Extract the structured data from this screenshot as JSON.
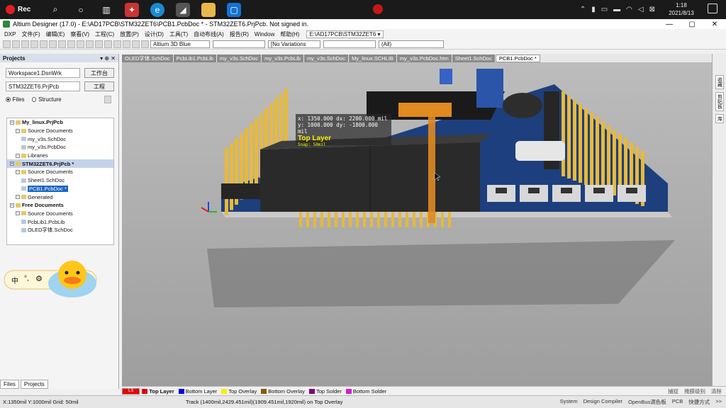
{
  "taskbar": {
    "rec_label": "Rec",
    "clock_time": "1:18",
    "clock_date": "2021/8/13"
  },
  "window": {
    "title": "Altium Designer (17.0) - E:\\AD17PCB\\STM32ZET6\\PCB1.PcbDoc * - STM32ZET6.PrjPcb. Not signed in."
  },
  "menu": {
    "items": [
      "DXP",
      "文件(F)",
      "编辑(E)",
      "察看(V)",
      "工程(C)",
      "放置(P)",
      "设计(D)",
      "工具(T)",
      "自动布线(A)",
      "报告(R)",
      "Window",
      "帮助(H)"
    ],
    "path": "E:\\AD17PCB\\STM32ZET6 ▾"
  },
  "toolbar": {
    "view_config": "Altium 3D Blue",
    "variations": "[No Variations",
    "filter": "(All)"
  },
  "projects_panel": {
    "title": "Projects",
    "workspace_value": "Workspace1.DsnWrk",
    "workspace_button": "工作台",
    "project_value": "STM32ZET6.PrjPcb",
    "project_button": "工程",
    "radio_files": "Files",
    "radio_structure": "Structure",
    "tree": [
      {
        "label": "My_linux.PrjPcb",
        "level": 0,
        "bold": true,
        "kind": "project"
      },
      {
        "label": "Source Documents",
        "level": 1,
        "kind": "folder"
      },
      {
        "label": "my_v3s.SchDoc",
        "level": 2,
        "kind": "doc"
      },
      {
        "label": "my_v3s.PcbDoc",
        "level": 2,
        "kind": "doc"
      },
      {
        "label": "Libraries",
        "level": 1,
        "kind": "folder"
      },
      {
        "label": "STM32ZET6.PrjPcb *",
        "level": 0,
        "bold": true,
        "kind": "project",
        "highlight": true
      },
      {
        "label": "Source Documents",
        "level": 1,
        "kind": "folder"
      },
      {
        "label": "Sheet1.SchDoc",
        "level": 2,
        "kind": "doc"
      },
      {
        "label": "PCB1.PcbDoc *",
        "level": 2,
        "kind": "doc",
        "selected": true
      },
      {
        "label": "Generated",
        "level": 1,
        "kind": "folder"
      },
      {
        "label": "Free Documents",
        "level": 0,
        "bold": true,
        "kind": "project"
      },
      {
        "label": "Source Documents",
        "level": 1,
        "kind": "folder"
      },
      {
        "label": "PcbLib1.PcbLib",
        "level": 2,
        "kind": "doc"
      },
      {
        "label": "OLED字体.SchDoc",
        "level": 2,
        "kind": "doc"
      }
    ],
    "bottom_tabs": [
      "Files",
      "Projects"
    ]
  },
  "ime": {
    "label": "中"
  },
  "doc_tabs": [
    "OLED字体.SchDoc",
    "PcbLib1.PcbLib",
    "my_v3s.SchDoc",
    "my_v3s.PcbLib",
    "my_v3s.SchDoc",
    "My_linux.SCHLIB",
    "my_v3s.PcbDoc.htm",
    "Sheet1.SchDoc",
    "PCB1.PcbDoc *"
  ],
  "hud": {
    "line1": "x:  1350.000  dx:  2200.000 mil",
    "line2": "y:  1000.000  dy:  -1800.000 mil",
    "layer": "Top Layer",
    "snap": "Snap: 50mil"
  },
  "layers": [
    {
      "name": "Top Layer",
      "color": "#e00000",
      "bold": true
    },
    {
      "name": "Bottom Layer",
      "color": "#0000e0"
    },
    {
      "name": "Top Overlay",
      "color": "#f5f000"
    },
    {
      "name": "Bottom Overlay",
      "color": "#8b5a00"
    },
    {
      "name": "Top Solder",
      "color": "#800080"
    },
    {
      "name": "Bottom Solder",
      "color": "#d020d0"
    }
  ],
  "layer_ls": "LS",
  "layerbar_right": [
    "捕捉",
    "掩膜级别",
    "清除"
  ],
  "status": {
    "coords": "X:1350mil Y:1000mil  Grid: 50mil",
    "track": "Track (1400mil,2429.451mil)(1909.451mil,1920mil) on Top Overlay",
    "right": [
      "System",
      "Design Compiler",
      "OpenBus调色板",
      "PCB",
      "快捷方式",
      ">>"
    ]
  },
  "right_panels": [
    "收藏",
    "剪贴板",
    "库"
  ],
  "colors": {
    "pcb_board": "#1d3f7d",
    "pin_header": "#e8b93a",
    "viewport_bg": "#b0b0b0"
  }
}
